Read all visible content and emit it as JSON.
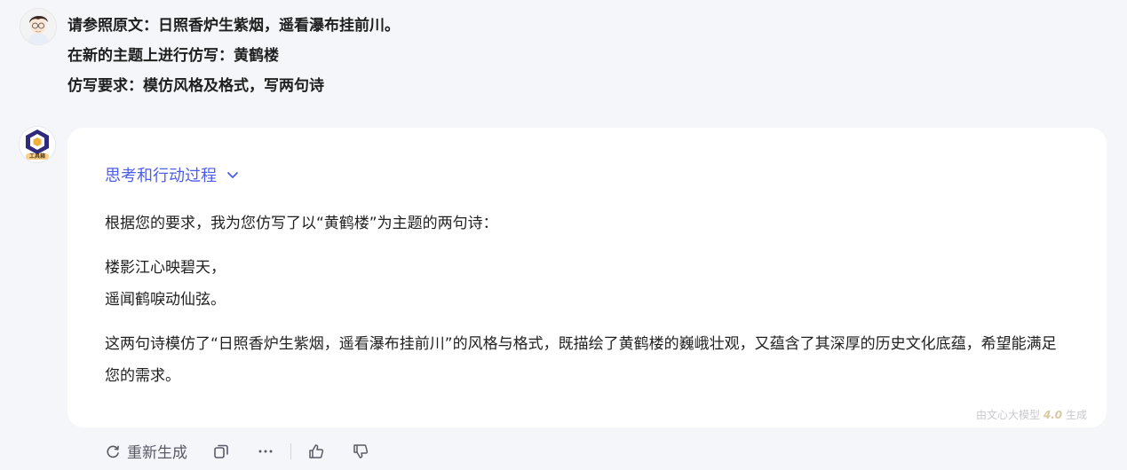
{
  "user": {
    "avatar_icon": "user-avatar-icon",
    "lines": [
      "请参照原文：日照香炉生紫烟，遥看瀑布挂前川。",
      "在新的主题上进行仿写：黄鹤楼",
      "仿写要求：模仿风格及格式，写两句诗"
    ]
  },
  "bot": {
    "avatar_icon": "toolbox-logo-icon",
    "brand_text": "工具箱",
    "thinking_label": "思考和行动过程",
    "intro": "根据您的要求，我为您仿写了以“黄鹤楼”为主题的两句诗：",
    "poem": [
      "楼影江心映碧天，",
      "遥闻鹤唳动仙弦。"
    ],
    "summary": "这两句诗模仿了“日照香炉生紫烟，遥看瀑布挂前川”的风格与格式，既描绘了黄鹤楼的巍峨壮观，又蕴含了其深厚的历史文化底蕴，希望能满足您的需求。",
    "model_note_prefix": "由文心大模型",
    "model_note_version": "4.0",
    "model_note_suffix": "生成"
  },
  "actions": {
    "regenerate_label": "重新生成",
    "copy_icon": "copy-icon",
    "more_icon": "more-icon",
    "like_icon": "thumbs-up-icon",
    "dislike_icon": "thumbs-down-icon"
  },
  "colors": {
    "accent": "#4e5dea",
    "background": "#f5f6fa",
    "bubble": "#ffffff"
  }
}
